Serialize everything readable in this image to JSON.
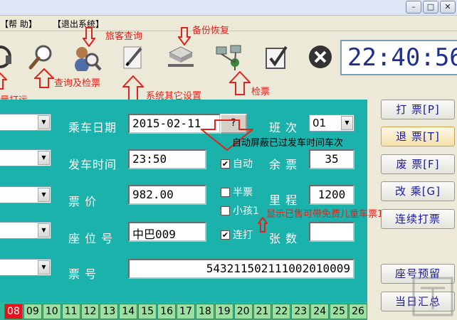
{
  "menu": {
    "help": "【帮 助】",
    "exit": "【退出系统】"
  },
  "clock": "22:40:56",
  "annotations": {
    "passenger_query": "旅客查询",
    "backup_restore": "备份恢复",
    "query_check": "查询及检票",
    "system_settings": "系统其它设置",
    "check_ticket": "检票",
    "bulk_ship": "量打运",
    "auto_hide": "自动屏蔽已过发车时间车次",
    "child_tickets": "显示已售可带免费儿童车票1张"
  },
  "form": {
    "date_label": "乘车日期",
    "date_value": "2015-02-11",
    "question_button": "?",
    "shift_label": "班 次",
    "shift_value": "01",
    "depart_label": "发车时间",
    "depart_value": "23:50",
    "auto_label": "自动",
    "remain_label": "余 票",
    "remain_value": "35",
    "price_label": "票    价",
    "price_value": "982.00",
    "half_label": "半票",
    "child_label": "小孩1",
    "mileage_label": "里 程",
    "mileage_value": "1200",
    "seat_label": "座 位 号",
    "seat_value": "中巴009",
    "continuous_label": "连打",
    "count_label": "张 数",
    "count_value": "",
    "ticket_no_label": "票    号",
    "ticket_no_value": "543211502111002010009"
  },
  "checks": {
    "auto": true,
    "half": false,
    "child": false,
    "continuous": true
  },
  "buttons": {
    "print": "打 票[P]",
    "refund": "退 票[T]",
    "void": "废 票[F]",
    "change": "改 乘[G]",
    "continuous_print": "连续打票",
    "seat_reserve": "座号预留",
    "daily_summary": "当日汇总"
  },
  "seats": [
    {
      "no": "08",
      "taken": true
    },
    {
      "no": "09",
      "taken": false
    },
    {
      "no": "10",
      "taken": false
    },
    {
      "no": "11",
      "taken": false
    },
    {
      "no": "12",
      "taken": false
    },
    {
      "no": "13",
      "taken": false
    },
    {
      "no": "14",
      "taken": false
    },
    {
      "no": "15",
      "taken": false
    },
    {
      "no": "16",
      "taken": false
    },
    {
      "no": "17",
      "taken": false
    },
    {
      "no": "18",
      "taken": false
    },
    {
      "no": "19",
      "taken": false
    },
    {
      "no": "20",
      "taken": false
    },
    {
      "no": "21",
      "taken": false
    },
    {
      "no": "22",
      "taken": false
    },
    {
      "no": "23",
      "taken": false
    },
    {
      "no": "24",
      "taken": false
    },
    {
      "no": "25",
      "taken": false
    },
    {
      "no": "26",
      "taken": false
    }
  ],
  "colors": {
    "panel": "#1bb2ab",
    "annotation": "#e0231c",
    "clock_text": "#1e2f8e"
  }
}
